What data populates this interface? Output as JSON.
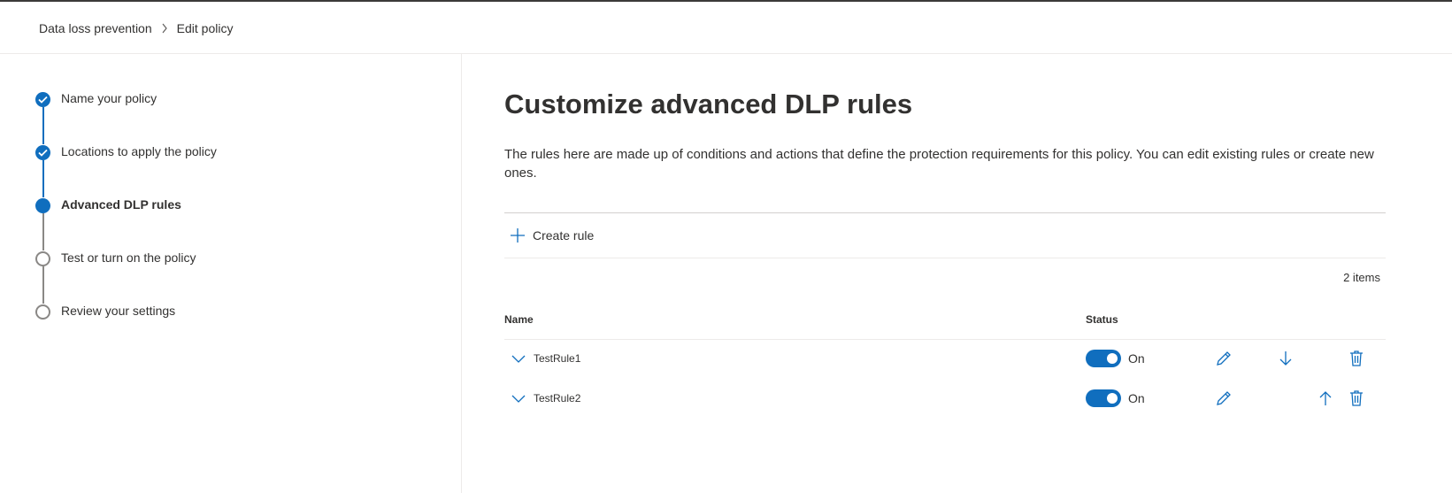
{
  "breadcrumb": {
    "root": "Data loss prevention",
    "current": "Edit policy"
  },
  "steps": [
    {
      "label": "Name your policy",
      "state": "done"
    },
    {
      "label": "Locations to apply the policy",
      "state": "done"
    },
    {
      "label": "Advanced DLP rules",
      "state": "current"
    },
    {
      "label": "Test or turn on the policy",
      "state": "todo"
    },
    {
      "label": "Review your settings",
      "state": "todo"
    }
  ],
  "main": {
    "title": "Customize advanced DLP rules",
    "description": "The rules here are made up of conditions and actions that define the protection requirements for this policy. You can edit existing rules or create new ones.",
    "create_rule_label": "Create rule",
    "item_count": "2 items",
    "columns": {
      "name": "Name",
      "status": "Status"
    },
    "rules": [
      {
        "name": "TestRule1",
        "status": "On"
      },
      {
        "name": "TestRule2",
        "status": "On"
      }
    ]
  },
  "colors": {
    "accent": "#106ebe",
    "text": "#323130",
    "inactive_step": "#8a8886"
  },
  "icons": {
    "breadcrumb_separator": "chevron-right-icon",
    "create": "plus-icon",
    "expand": "chevron-down-icon",
    "edit": "pencil-icon",
    "move_down": "arrow-down-icon",
    "move_up": "arrow-up-icon",
    "delete": "trash-icon",
    "step_done": "checkmark-icon"
  }
}
